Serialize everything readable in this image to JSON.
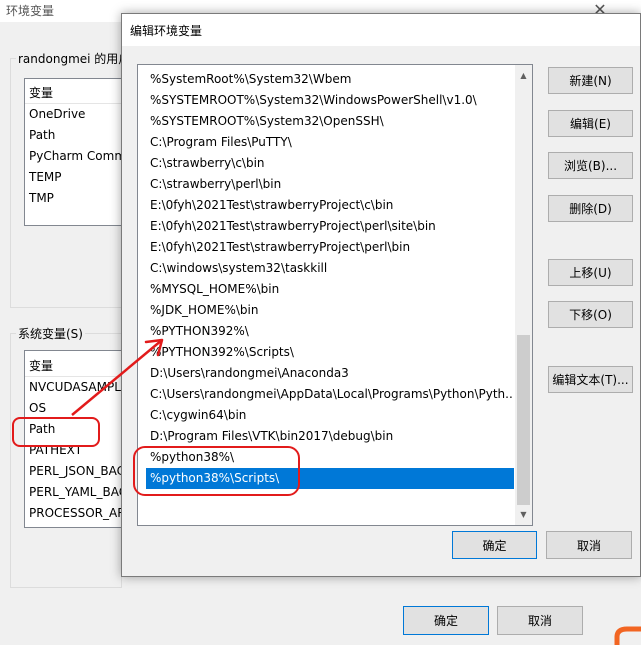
{
  "background_window": {
    "title": "环境变量",
    "close_glyph": "✕",
    "user_vars": {
      "group_label": "randongmei 的用户",
      "column_header": "变量",
      "rows": [
        "OneDrive",
        "Path",
        "PyCharm Comm",
        "TEMP",
        "TMP"
      ]
    },
    "system_vars": {
      "group_label": "系统变量(S)",
      "column_header": "变量",
      "rows": [
        "NVCUDASAMPL",
        "OS",
        "Path",
        "PATHEXT",
        "PERL_JSON_BAC",
        "PERL_YAML_BAC",
        "PROCESSOR_AR"
      ]
    },
    "ok_label": "确定",
    "cancel_label": "取消"
  },
  "edit_dialog": {
    "title": "编辑环境变量",
    "close_glyph": "✕",
    "paths": [
      "%SystemRoot%\\System32\\Wbem",
      "%SYSTEMROOT%\\System32\\WindowsPowerShell\\v1.0\\",
      "%SYSTEMROOT%\\System32\\OpenSSH\\",
      "C:\\Program Files\\PuTTY\\",
      "C:\\strawberry\\c\\bin",
      "C:\\strawberry\\perl\\bin",
      "E:\\0fyh\\2021Test\\strawberryProject\\c\\bin",
      "E:\\0fyh\\2021Test\\strawberryProject\\perl\\site\\bin",
      "E:\\0fyh\\2021Test\\strawberryProject\\perl\\bin",
      "C:\\windows\\system32\\taskkill",
      "%MYSQL_HOME%\\bin",
      "%JDK_HOME%\\bin",
      "%PYTHON392%\\",
      "%PYTHON392%\\Scripts\\",
      "D:\\Users\\randongmei\\Anaconda3",
      "C:\\Users\\randongmei\\AppData\\Local\\Programs\\Python\\Pyth...",
      "C:\\cygwin64\\bin",
      "D:\\Program Files\\VTK\\bin2017\\debug\\bin",
      "%python38%\\",
      "%python38%\\Scripts\\"
    ],
    "selected_index": 19,
    "buttons": {
      "new": "新建(N)",
      "edit": "编辑(E)",
      "browse": "浏览(B)...",
      "delete": "删除(D)",
      "move_up": "上移(U)",
      "move_down": "下移(O)",
      "edit_text": "编辑文本(T)...",
      "ok": "确定",
      "cancel": "取消"
    }
  },
  "colors": {
    "selection": "#0078d7",
    "annotation_red": "#e21b1b"
  }
}
